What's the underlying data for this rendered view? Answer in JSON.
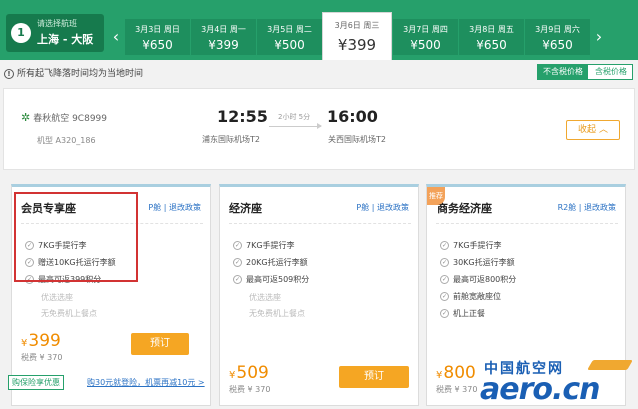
{
  "header": {
    "step_number": "1",
    "step_caption": "请选择航班",
    "route": "上海 - 大阪",
    "prev_arrow": "‹",
    "next_arrow": "›"
  },
  "dates": [
    {
      "label": "3月3日 周日",
      "price": "¥650",
      "selected": false
    },
    {
      "label": "3月4日 周一",
      "price": "¥399",
      "selected": false
    },
    {
      "label": "3月5日 周二",
      "price": "¥500",
      "selected": false
    },
    {
      "label": "3月6日 周三",
      "price": "¥399",
      "selected": true
    },
    {
      "label": "3月7日 周四",
      "price": "¥500",
      "selected": false
    },
    {
      "label": "3月8日 周五",
      "price": "¥650",
      "selected": false
    },
    {
      "label": "3月9日 周六",
      "price": "¥650",
      "selected": false
    }
  ],
  "notice": "所有起飞降落时间均为当地时间",
  "price_toggle": {
    "active": "不含税价格",
    "inactive": "含税价格"
  },
  "flight": {
    "airline": "春秋航空 9C8999",
    "model": "机型 A320_186",
    "dep_time": "12:55",
    "arr_time": "16:00",
    "duration": "2小时 5分",
    "dep_airport": "浦东国际机场T2",
    "arr_airport": "关西国际机场T2",
    "collapse_label": "收起"
  },
  "cards": [
    {
      "name": "会员专享座",
      "cabin": "P舱",
      "policy": "退改政策",
      "features": [
        "7KG手提行李",
        "赠送10KG托运行李额",
        "最高可返399积分"
      ],
      "unavailable": [
        "优选选座",
        "无免费机上餐点"
      ],
      "currency": "¥",
      "price": "399",
      "tax": "税费 ¥ 370",
      "book_label": "预订"
    },
    {
      "name": "经济座",
      "cabin": "P舱",
      "policy": "退改政策",
      "features": [
        "7KG手提行李",
        "20KG托运行李额",
        "最高可返509积分"
      ],
      "unavailable": [
        "优选选座",
        "无免费机上餐点"
      ],
      "currency": "¥",
      "price": "509",
      "tax": "税费 ¥ 370",
      "book_label": "预订"
    },
    {
      "name": "商务经济座",
      "cabin": "R2舱",
      "policy": "退改政策",
      "badge": "推荐",
      "features": [
        "7KG手提行李",
        "30KG托运行李额",
        "最高可返800积分",
        "前舱宽敞座位",
        "机上正餐"
      ],
      "currency": "¥",
      "price": "800",
      "tax": "税费 ¥ 370"
    }
  ],
  "promo": {
    "badge": "购保险享优惠",
    "link": "购30元就登险，机票再减10元 >"
  },
  "watermark": {
    "cn": "中国航空网",
    "en": "aero.cn"
  },
  "colors": {
    "brand_green": "#26a06b",
    "accent_orange": "#f5a623",
    "highlight_red": "#d23333",
    "link_blue": "#2b72c4"
  }
}
